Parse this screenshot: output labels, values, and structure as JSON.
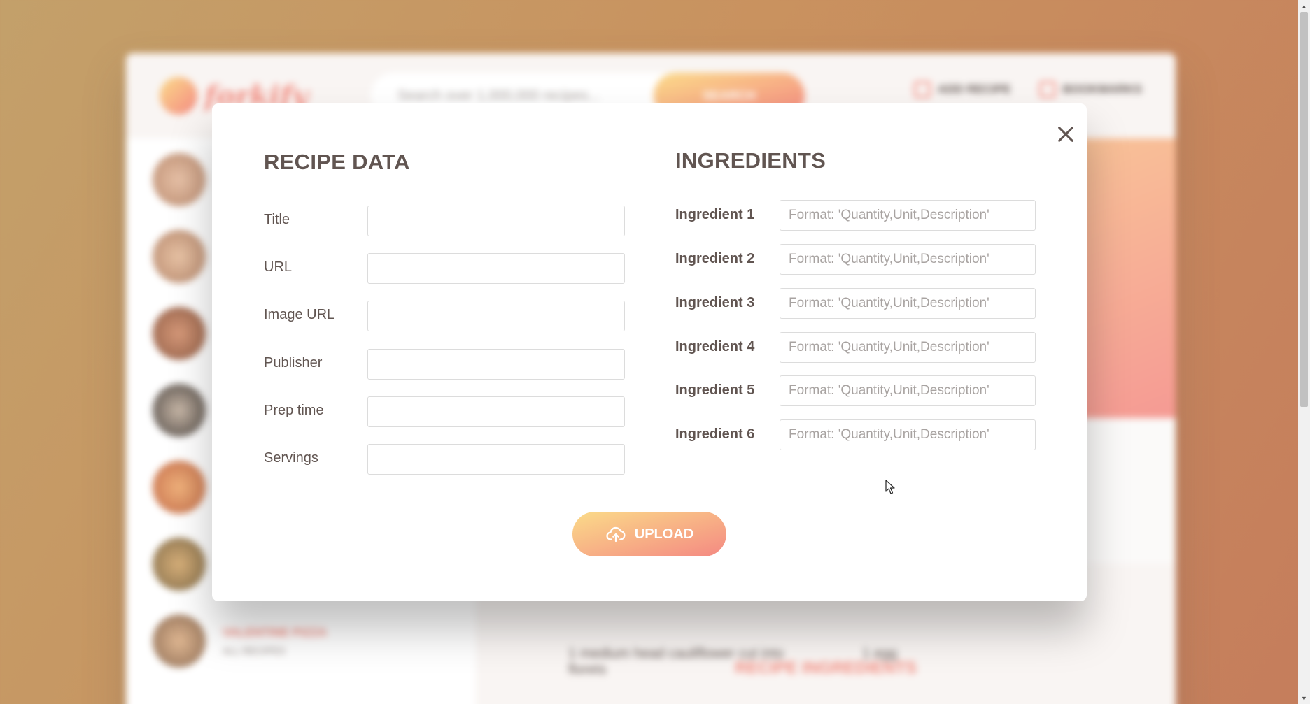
{
  "background_app": {
    "logo_text": "forkify",
    "search_placeholder": "Search over 1,000,000 recipes...",
    "search_button": "SEARCH",
    "nav": {
      "add_recipe": "ADD RECIPE",
      "bookmarks": "BOOKMARKS"
    },
    "results": [
      {
        "title": "",
        "publisher": ""
      },
      {
        "title": "",
        "publisher": ""
      },
      {
        "title": "",
        "publisher": ""
      },
      {
        "title": "",
        "publisher": ""
      },
      {
        "title": "",
        "publisher": ""
      },
      {
        "title": "",
        "publisher": ""
      },
      {
        "title": "VALENTINE PIZZA",
        "publisher": "ALL RECIPES"
      }
    ],
    "recipe_ingredients_heading": "RECIPE INGREDIENTS",
    "ingredients": [
      "1 medium head cauliflower cut into florets",
      "1 egg"
    ]
  },
  "modal": {
    "recipe_data_heading": "RECIPE DATA",
    "ingredients_heading": "INGREDIENTS",
    "recipe_fields": [
      {
        "label": "Title",
        "value": ""
      },
      {
        "label": "URL",
        "value": ""
      },
      {
        "label": "Image URL",
        "value": ""
      },
      {
        "label": "Publisher",
        "value": ""
      },
      {
        "label": "Prep time",
        "value": ""
      },
      {
        "label": "Servings",
        "value": ""
      }
    ],
    "ingredient_fields": [
      {
        "label": "Ingredient 1",
        "placeholder": "Format: 'Quantity,Unit,Description'"
      },
      {
        "label": "Ingredient 2",
        "placeholder": "Format: 'Quantity,Unit,Description'"
      },
      {
        "label": "Ingredient 3",
        "placeholder": "Format: 'Quantity,Unit,Description'"
      },
      {
        "label": "Ingredient 4",
        "placeholder": "Format: 'Quantity,Unit,Description'"
      },
      {
        "label": "Ingredient 5",
        "placeholder": "Format: 'Quantity,Unit,Description'"
      },
      {
        "label": "Ingredient 6",
        "placeholder": "Format: 'Quantity,Unit,Description'"
      }
    ],
    "upload_button": "UPLOAD",
    "close_icon": "close-icon",
    "upload_icon": "cloud-upload-icon"
  },
  "colors": {
    "accent": "#f38e82",
    "gradient_start": "#fbdb89",
    "gradient_end": "#f48982",
    "text": "#615551"
  }
}
